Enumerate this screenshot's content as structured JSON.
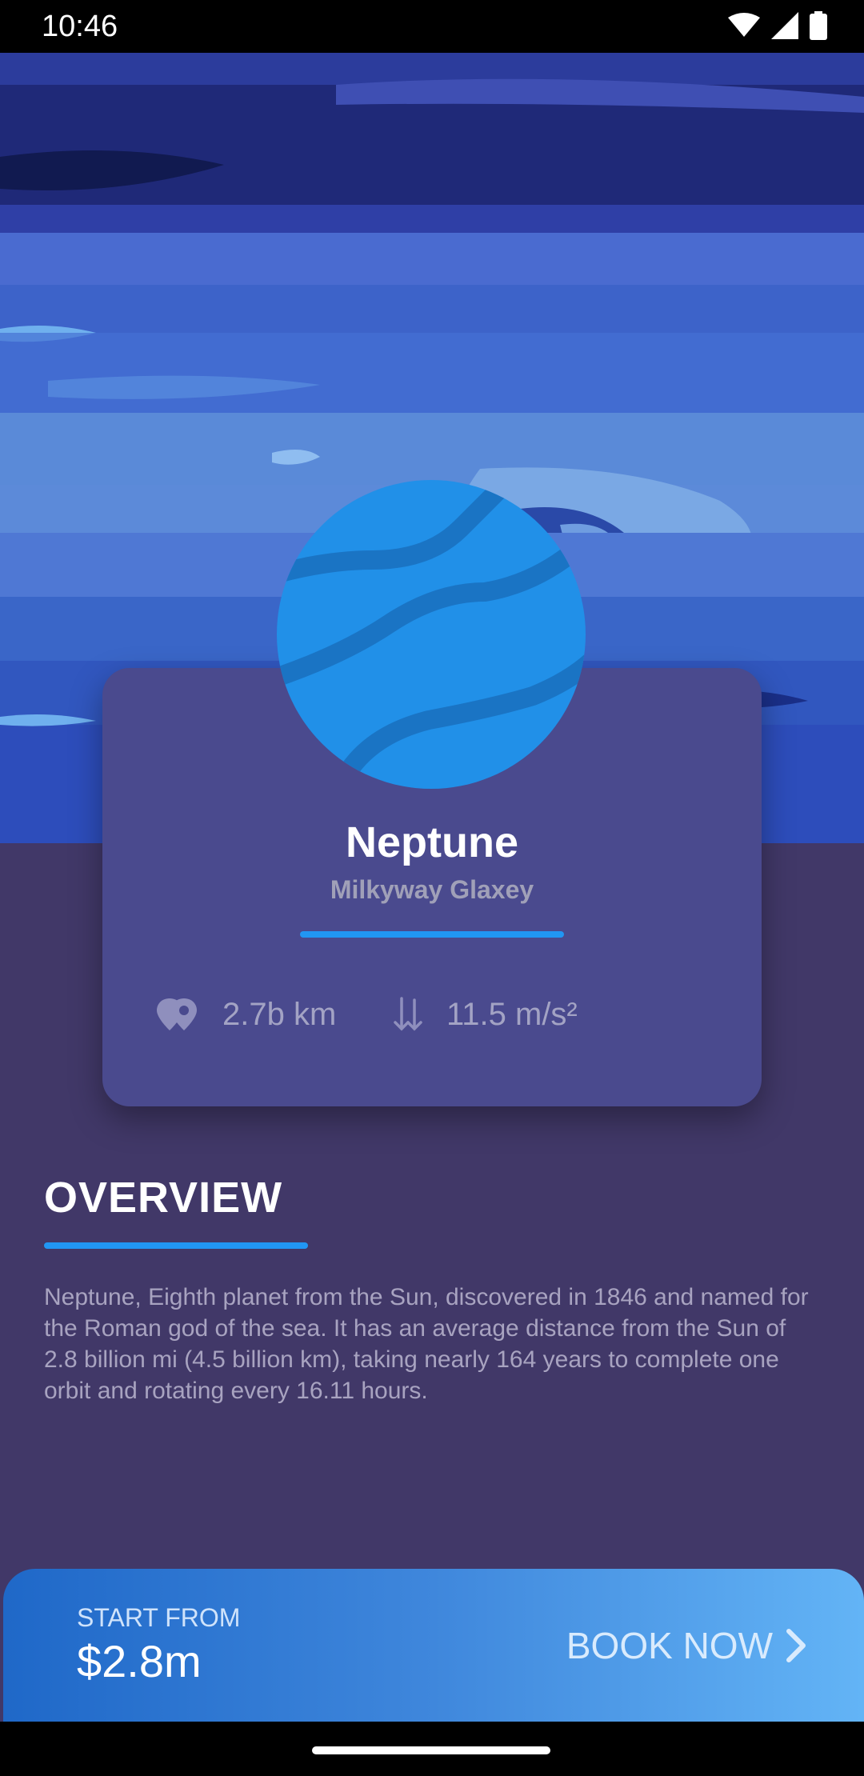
{
  "status_bar": {
    "time": "10:46"
  },
  "planet": {
    "name": "Neptune",
    "galaxy": "Milkyway Glaxey",
    "distance": "2.7b km",
    "gravity": "11.5 m/s²",
    "color": "#2190e8"
  },
  "overview": {
    "title": "OVERVIEW",
    "text": "Neptune, Eighth planet from the Sun, discovered in 1846 and named for the Roman god of the sea. It has an average distance from the Sun of 2.8 billion mi (4.5 billion km), taking nearly 164 years to complete one orbit and rotating every 16.11 hours."
  },
  "booking": {
    "start_label": "START FROM",
    "price": "$2.8m",
    "action_label": "BOOK NOW"
  },
  "colors": {
    "background": "#413868",
    "card": "#4a4a8e",
    "accent": "#2196f3"
  },
  "icons": {
    "distance": "map-marker-icon",
    "gravity": "gravity-arrows-icon",
    "book": "chevron-right-icon"
  }
}
